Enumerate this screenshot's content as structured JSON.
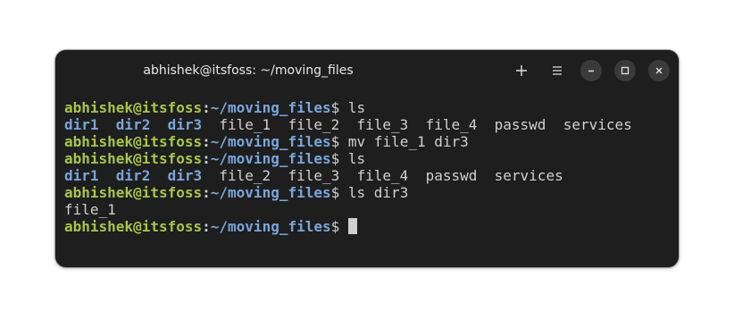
{
  "window": {
    "title": "abhishek@itsfoss: ~/moving_files",
    "buttons": {
      "new_tab": "+",
      "menu": "☰"
    }
  },
  "prompt": {
    "user_host": "abhishek@itsfoss",
    "colon": ":",
    "path": "~/moving_files",
    "symbol": "$ "
  },
  "terminal": {
    "lines": [
      {
        "kind": "prompt",
        "command": "ls"
      },
      {
        "kind": "ls",
        "dirs": [
          "dir1",
          "dir2",
          "dir3"
        ],
        "files": [
          "file_1",
          "file_2",
          "file_3",
          "file_4",
          "passwd",
          "services"
        ]
      },
      {
        "kind": "prompt",
        "command": "mv file_1 dir3"
      },
      {
        "kind": "prompt",
        "command": "ls"
      },
      {
        "kind": "ls",
        "dirs": [
          "dir1",
          "dir2",
          "dir3"
        ],
        "files": [
          "file_2",
          "file_3",
          "file_4",
          "passwd",
          "services"
        ]
      },
      {
        "kind": "prompt",
        "command": "ls dir3"
      },
      {
        "kind": "output",
        "text": "file_1"
      },
      {
        "kind": "prompt",
        "command": "",
        "cursor": true
      }
    ]
  },
  "colors": {
    "background": "#1e1e1e",
    "user_host": "#a9c44d",
    "path": "#7aa6da",
    "directory": "#7aa6da",
    "text": "#d0d0d0"
  }
}
